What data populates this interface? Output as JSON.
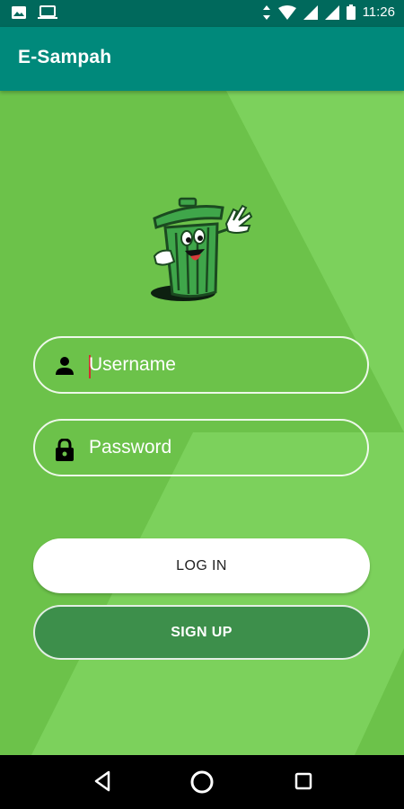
{
  "status_bar": {
    "time": "11:26",
    "left_icons": [
      "image-icon",
      "laptop-icon"
    ],
    "right_icons": [
      "data-arrows-icon",
      "wifi-icon",
      "signal-icon",
      "signal-icon",
      "battery-icon"
    ]
  },
  "app_bar": {
    "title": "E-Sampah"
  },
  "login_form": {
    "username_placeholder": "Username",
    "password_placeholder": "Password",
    "login_label": "LOG IN",
    "signup_label": "SIGN UP"
  },
  "colors": {
    "status_bar": "#00695c",
    "app_bar": "#00897b",
    "background": "#6cc24a",
    "signup_button": "#3d8f4b"
  },
  "nav_bar": {
    "icons": [
      "back-icon",
      "home-icon",
      "recents-icon"
    ]
  }
}
